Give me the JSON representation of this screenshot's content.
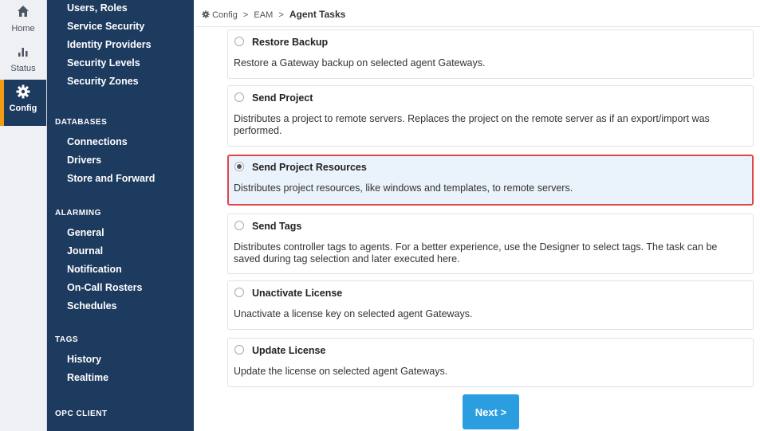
{
  "rail": {
    "home": "Home",
    "status": "Status",
    "config": "Config"
  },
  "sidebar": {
    "security_items": [
      "Users, Roles",
      "Service Security",
      "Identity Providers",
      "Security Levels",
      "Security Zones"
    ],
    "databases_heading": "DATABASES",
    "databases_items": [
      "Connections",
      "Drivers",
      "Store and Forward"
    ],
    "alarming_heading": "ALARMING",
    "alarming_items": [
      "General",
      "Journal",
      "Notification",
      "On-Call Rosters",
      "Schedules"
    ],
    "tags_heading": "TAGS",
    "tags_items": [
      "History",
      "Realtime"
    ],
    "opc_heading": "OPC CLIENT"
  },
  "breadcrumb": {
    "icon": "gear-icon",
    "items": [
      "Config",
      "EAM"
    ],
    "separator": ">",
    "current": "Agent Tasks"
  },
  "tasks": [
    {
      "title": "Restore Backup",
      "desc": "Restore a Gateway backup on selected agent Gateways.",
      "selected": false
    },
    {
      "title": "Send Project",
      "desc": "Distributes a project to remote servers. Replaces the project on the remote server as if an export/import was performed.",
      "selected": false
    },
    {
      "title": "Send Project Resources",
      "desc": "Distributes project resources, like windows and templates, to remote servers.",
      "selected": true
    },
    {
      "title": "Send Tags",
      "desc": "Distributes controller tags to agents. For a better experience, use the Designer to select tags. The task can be saved during tag selection and later executed here.",
      "selected": false
    },
    {
      "title": "Unactivate License",
      "desc": "Unactivate a license key on selected agent Gateways.",
      "selected": false
    },
    {
      "title": "Update License",
      "desc": "Update the license on selected agent Gateways.",
      "selected": false
    }
  ],
  "next_button": "Next >",
  "colors": {
    "sidebar": "#1d3a5f",
    "accent": "#f39c12",
    "highlight_border": "#e0454b",
    "button": "#2a9ee0"
  }
}
